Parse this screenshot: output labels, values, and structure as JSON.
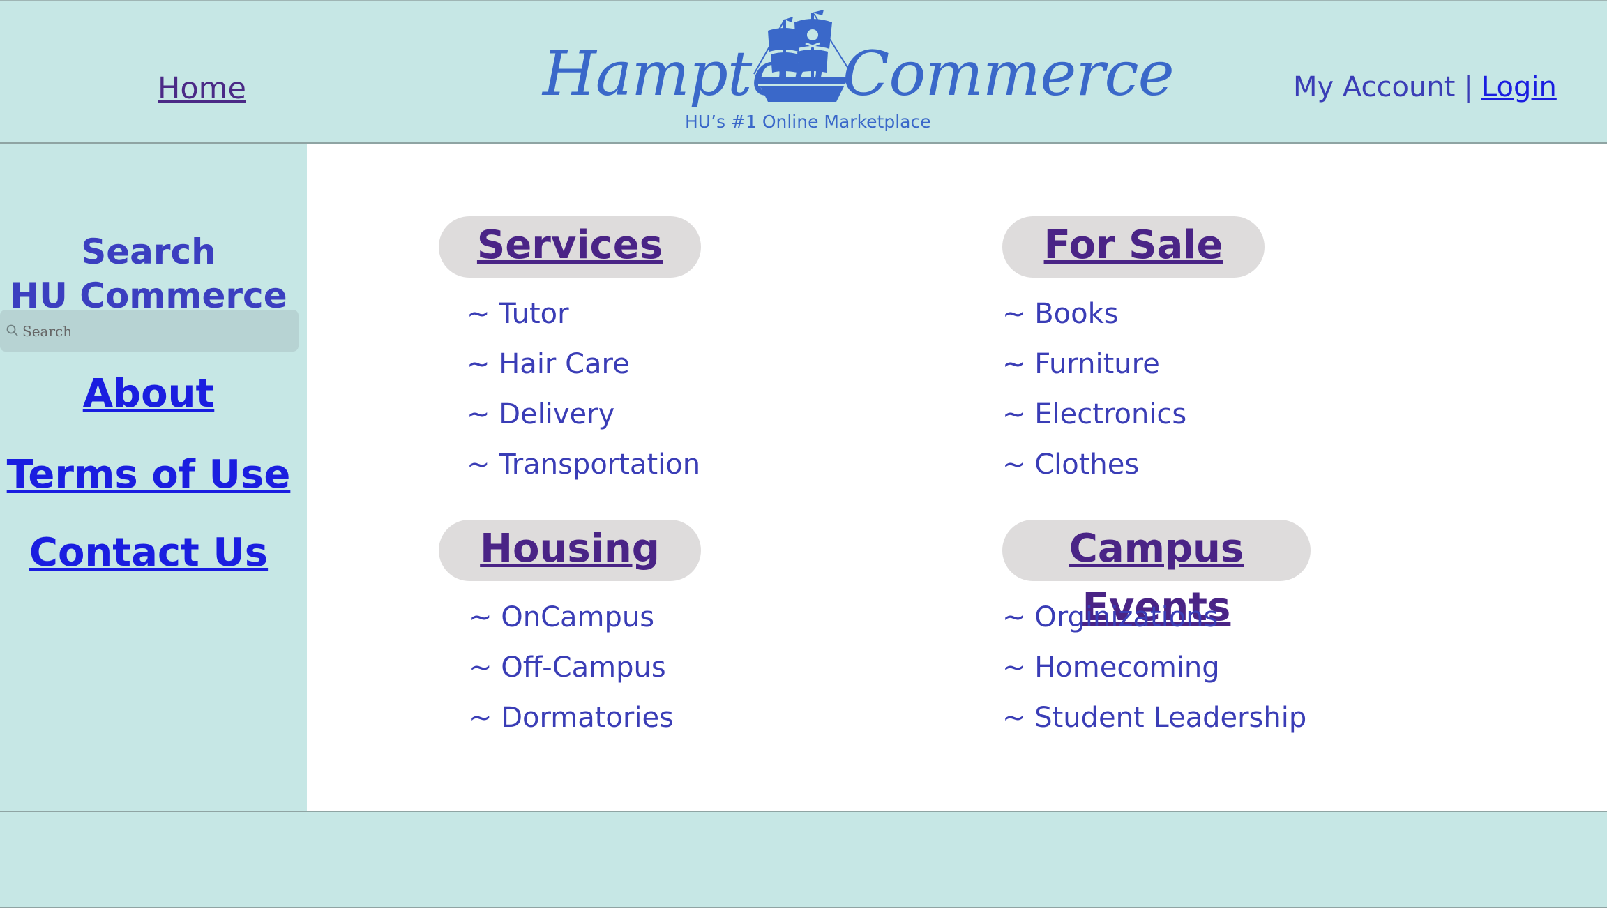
{
  "header": {
    "home_label": "Home",
    "logo": {
      "word_left": "Hampton",
      "word_right": "Commerce",
      "tagline": "HU’s #1 Online Marketplace",
      "emblem_icon": "pirate-ship-icon"
    },
    "my_account_label": "My Account",
    "separator": "|",
    "login_label": "Login"
  },
  "sidebar": {
    "search_title_line1": "Search",
    "search_title_line2": "HU Commerce",
    "search_placeholder": "Search",
    "links": [
      "About",
      "Terms of Use",
      "Contact Us"
    ]
  },
  "categories": [
    {
      "title": "Services",
      "items": [
        "~ Tutor",
        "~ Hair Care",
        "~ Delivery",
        "~ Transportation"
      ]
    },
    {
      "title": "For Sale",
      "items": [
        "~ Books",
        "~ Furniture",
        "~ Electronics",
        "~ Clothes"
      ]
    },
    {
      "title": "Housing",
      "items": [
        "~ OnCampus",
        "~ Off-Campus",
        "~ Dormatories"
      ]
    },
    {
      "title": "Campus Events",
      "items": [
        "~ Orginizations",
        "~ Homecoming",
        "~ Student Leadership"
      ]
    }
  ],
  "colors": {
    "panel_bg": "#c6e7e5",
    "pill_bg": "#dedcdc",
    "heading": "#4a2486",
    "list_text": "#3a3db6",
    "link_blue": "#1a1ee0",
    "logo_blue": "#3a68c9"
  }
}
